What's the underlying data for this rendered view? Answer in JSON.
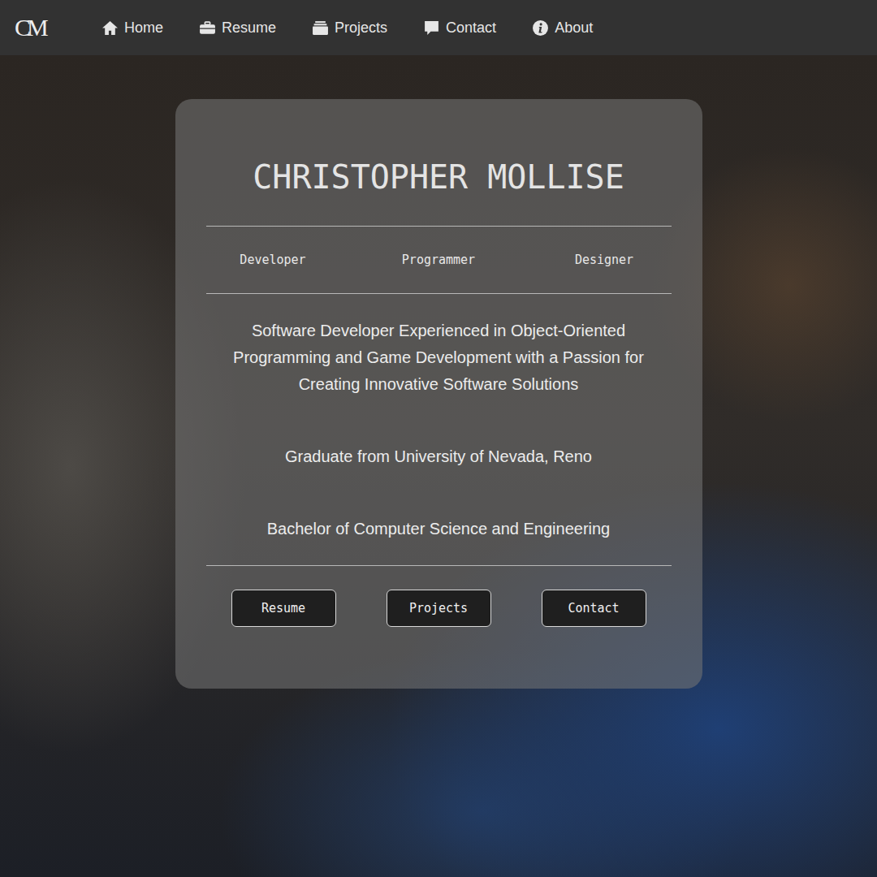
{
  "nav": {
    "logo": "CM",
    "items": [
      {
        "label": "Home"
      },
      {
        "label": "Resume"
      },
      {
        "label": "Projects"
      },
      {
        "label": "Contact"
      },
      {
        "label": "About"
      }
    ]
  },
  "card": {
    "title": "CHRISTOPHER MOLLISE",
    "roles": [
      "Developer",
      "Programmer",
      "Designer"
    ],
    "summary": "Software Developer Experienced in Object-Oriented Programming and Game Development with a Passion for Creating Innovative Software Solutions",
    "education": [
      "Graduate from University of Nevada, Reno",
      "Bachelor of Computer Science and Engineering"
    ],
    "buttons": [
      "Resume",
      "Projects",
      "Contact"
    ]
  }
}
